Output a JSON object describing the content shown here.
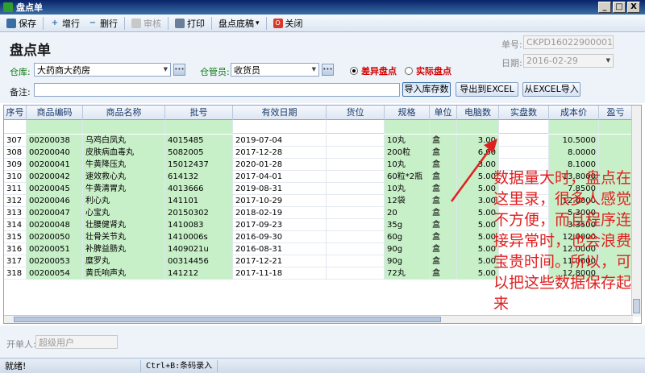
{
  "window": {
    "title": "盘点单",
    "min": "_",
    "max": "□",
    "close": "X"
  },
  "toolbar": {
    "save": "保存",
    "add_row": "增行",
    "delete_row": "删行",
    "review": "审核",
    "print": "打印",
    "base": "盘点底稿",
    "base_arrow": "▾",
    "close": "关闭"
  },
  "form": {
    "title": "盘点单",
    "order_no_label": "单号:",
    "order_no": "CKPD16022900001",
    "date_label": "日期:",
    "date": "2016-02-29",
    "warehouse_label": "仓库:",
    "warehouse": "大药商大药房",
    "keeper_label": "仓管员:",
    "keeper": "收货员",
    "radio_diff": "差异盘点",
    "radio_actual": "实际盘点",
    "remark_label": "备注:",
    "remark": "",
    "btn_import_stock": "导入库存数",
    "btn_export_excel": "导出到EXCEL",
    "btn_import_excel": "从EXCEL导入"
  },
  "grid": {
    "columns": [
      "序号",
      "商品编码",
      "商品名称",
      "批号",
      "有效日期",
      "货位",
      "规格",
      "单位",
      "电脑数",
      "实盘数",
      "成本价",
      "盈亏"
    ],
    "rows": [
      {
        "seq": "307",
        "code": "00200038",
        "name": "乌鸡白凤丸",
        "batch": "4015485",
        "expiry": "2019-07-04",
        "loc": "",
        "spec": "10丸",
        "unit": "盒",
        "pc": "3.00",
        "actual": "",
        "cost": "10.5000"
      },
      {
        "seq": "308",
        "code": "00200040",
        "name": "皮肤病血毒丸",
        "batch": "5082005",
        "expiry": "2017-12-28",
        "loc": "",
        "spec": "200粒",
        "unit": "盒",
        "pc": "6.00",
        "actual": "",
        "cost": "8.0000"
      },
      {
        "seq": "309",
        "code": "00200041",
        "name": "牛黄降压丸",
        "batch": "15012437",
        "expiry": "2020-01-28",
        "loc": "",
        "spec": "10丸",
        "unit": "盒",
        "pc": "3.00",
        "actual": "",
        "cost": "8.1000"
      },
      {
        "seq": "310",
        "code": "00200042",
        "name": "速效救心丸",
        "batch": "614132",
        "expiry": "2017-04-01",
        "loc": "",
        "spec": "60粒*2瓶",
        "unit": "盒",
        "pc": "5.00",
        "actual": "",
        "cost": "13.8000"
      },
      {
        "seq": "311",
        "code": "00200045",
        "name": "牛黄清胃丸",
        "batch": "4013666",
        "expiry": "2019-08-31",
        "loc": "",
        "spec": "10丸",
        "unit": "盒",
        "pc": "5.00",
        "actual": "",
        "cost": "7.8500"
      },
      {
        "seq": "312",
        "code": "00200046",
        "name": "利心丸",
        "batch": "141101",
        "expiry": "2017-10-29",
        "loc": "",
        "spec": "12袋",
        "unit": "盒",
        "pc": "3.00",
        "actual": "",
        "cost": "12.0000"
      },
      {
        "seq": "313",
        "code": "00200047",
        "name": "心宝丸",
        "batch": "20150302",
        "expiry": "2018-02-19",
        "loc": "",
        "spec": "20",
        "unit": "盒",
        "pc": "5.00",
        "actual": "",
        "cost": "5.3000"
      },
      {
        "seq": "314",
        "code": "00200048",
        "name": "壮腰健肾丸",
        "batch": "1410083",
        "expiry": "2017-09-23",
        "loc": "",
        "spec": "35g",
        "unit": "盒",
        "pc": "5.00",
        "actual": "",
        "cost": "3.3500"
      },
      {
        "seq": "315",
        "code": "00200050",
        "name": "壮骨关节丸",
        "batch": "1410006s",
        "expiry": "2016-09-30",
        "loc": "",
        "spec": "60g",
        "unit": "盒",
        "pc": "5.00",
        "actual": "",
        "cost": "12.0000"
      },
      {
        "seq": "316",
        "code": "00200051",
        "name": "补脾益肠丸",
        "batch": "1409021u",
        "expiry": "2016-08-31",
        "loc": "",
        "spec": "90g",
        "unit": "盒",
        "pc": "5.00",
        "actual": "",
        "cost": "12.0000"
      },
      {
        "seq": "317",
        "code": "00200053",
        "name": "糜罗丸",
        "batch": "00314456",
        "expiry": "2017-12-21",
        "loc": "",
        "spec": "90g",
        "unit": "盒",
        "pc": "5.00",
        "actual": "",
        "cost": "11.0000"
      },
      {
        "seq": "318",
        "code": "00200054",
        "name": "黄氏响声丸",
        "batch": "141212",
        "expiry": "2017-11-18",
        "loc": "",
        "spec": "72丸",
        "unit": "盒",
        "pc": "5.00",
        "actual": "",
        "cost": "12.8000"
      }
    ]
  },
  "footer": {
    "creator_label": "开单人:",
    "creator": "超级用户"
  },
  "status": {
    "ready": "就绪!",
    "shortcut": "Ctrl+B:条码录入"
  },
  "annotation": {
    "text": "数据量大时，盘点在这里录，很多人感觉不方便，而且程序连接异常时，也会浪费宝贵时间。所以，可以把这些数据保存起来"
  },
  "colors": {
    "accent_red": "#e02020",
    "green_column": "#c8f0c8"
  },
  "icons": {
    "window": "app-icon",
    "save": "save-icon",
    "add": "plus-icon",
    "delete": "minus-icon",
    "review": "check-icon",
    "print": "printer-icon",
    "close": "close-icon"
  }
}
